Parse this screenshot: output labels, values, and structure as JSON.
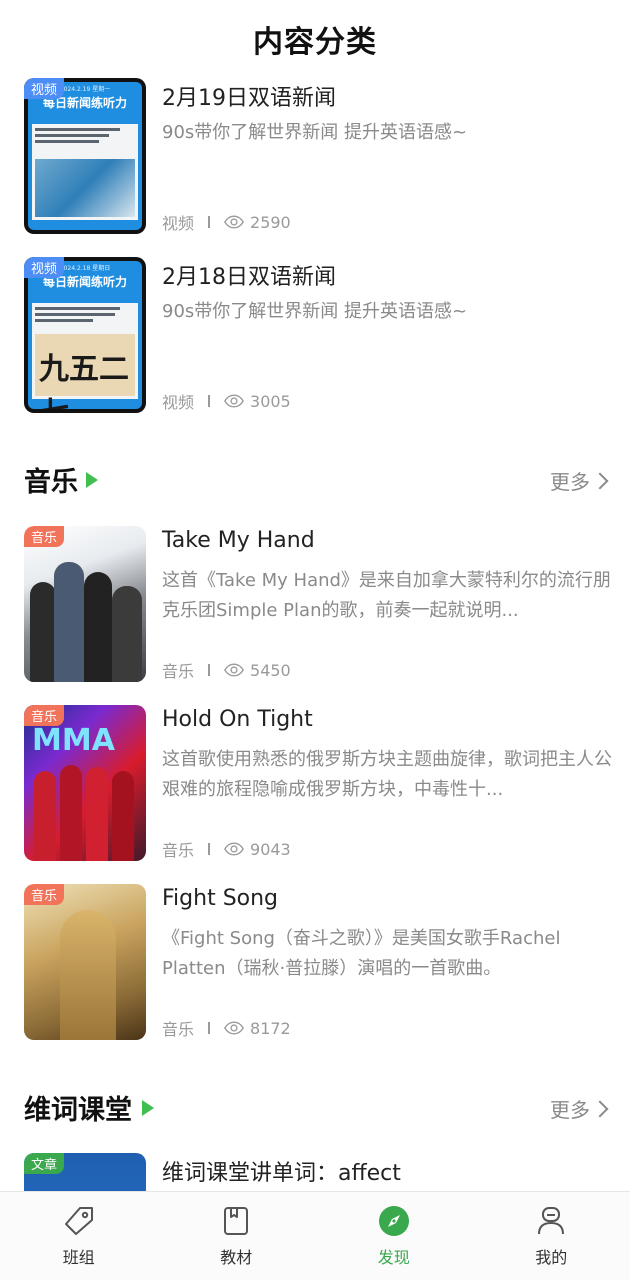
{
  "header": {
    "title": "内容分类"
  },
  "videos": [
    {
      "tag": "视频",
      "thumb_date": "2024.2.19 星期一",
      "thumb_headline": "每日新闻练听力",
      "title": "2月19日双语新闻",
      "desc": "90s带你了解世界新闻 提升英语语感~",
      "category": "视频",
      "views": "2590"
    },
    {
      "tag": "视频",
      "thumb_date": "2024.2.18 星期日",
      "thumb_headline": "每日新闻练听力",
      "title": "2月18日双语新闻",
      "desc": "90s带你了解世界新闻 提升英语语感~",
      "category": "视频",
      "views": "3005"
    }
  ],
  "music_section": {
    "title": "音乐",
    "more": "更多",
    "items": [
      {
        "tag": "音乐",
        "title": "Take My Hand",
        "desc": "这首《Take My Hand》是来自加拿大蒙特利尔的流行朋克乐团Simple Plan的歌，前奏一起就说明...",
        "category": "音乐",
        "views": "5450"
      },
      {
        "tag": "音乐",
        "thumb_text": "MMA",
        "title": "Hold On Tight",
        "desc": "这首歌使用熟悉的俄罗斯方块主题曲旋律，歌词把主人公艰难的旅程隐喻成俄罗斯方块，中毒性十...",
        "category": "音乐",
        "views": "9043"
      },
      {
        "tag": "音乐",
        "title": "Fight Song",
        "desc": "《Fight Song（奋斗之歌）》是美国女歌手Rachel Platten（瑞秋·普拉滕）演唱的一首歌曲。",
        "category": "音乐",
        "views": "8172"
      }
    ]
  },
  "vocab_section": {
    "title": "维词课堂",
    "more": "更多",
    "items": [
      {
        "tag": "文章",
        "title": "维词课堂讲单词：affect"
      }
    ]
  },
  "tabbar": {
    "tabs": [
      {
        "label": "班组",
        "icon": "tag-icon"
      },
      {
        "label": "教材",
        "icon": "book-icon"
      },
      {
        "label": "发现",
        "icon": "compass-icon",
        "active": true
      },
      {
        "label": "我的",
        "icon": "profile-icon"
      }
    ]
  },
  "colors": {
    "accent": "#3aa84d",
    "video_tag": "#4d8df6",
    "music_tag": "#f0735a",
    "article_tag": "#3aa84d"
  }
}
